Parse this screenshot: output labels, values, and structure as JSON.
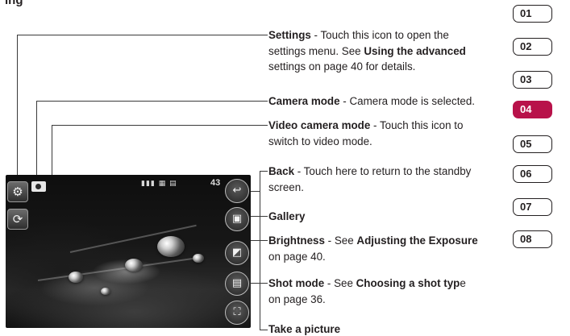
{
  "heading": "ing",
  "callouts": {
    "settings": {
      "title": "Settings",
      "l1": " - Touch this icon to open the",
      "l2": "settings menu. See ",
      "l2b": "Using the advanced",
      "l3": "settings on page 40 for details."
    },
    "camera_mode": {
      "title": "Camera mode",
      "l1": " - Camera mode is selected."
    },
    "video_mode": {
      "title": "Video camera mode",
      "l1": " - Touch this icon to",
      "l2": "switch to video mode."
    },
    "back": {
      "title": "Back",
      "l1": " - Touch here to return to the standby",
      "l2": "screen."
    },
    "gallery": {
      "title": "Gallery"
    },
    "brightness": {
      "title": "Brightness",
      "l1": " - See ",
      "l1b": "Adjusting the Exposure",
      "l2": "on page 40."
    },
    "shot_mode": {
      "title": "Shot mode",
      "l1": " - See ",
      "l1b": "Choosing a shot typ",
      "l1c": "e",
      "l2": "on page 36."
    },
    "take_picture": {
      "title": "Take a picture"
    }
  },
  "screen": {
    "shots_remaining": "43",
    "status_icons": "▮▮▮ ▦ ▤"
  },
  "tabs": [
    "01",
    "02",
    "03",
    "04",
    "05",
    "06",
    "07",
    "08"
  ],
  "active_tab": "04",
  "colors": {
    "accent": "#b8124a",
    "text": "#231f20",
    "line": "#3a3a3a"
  }
}
